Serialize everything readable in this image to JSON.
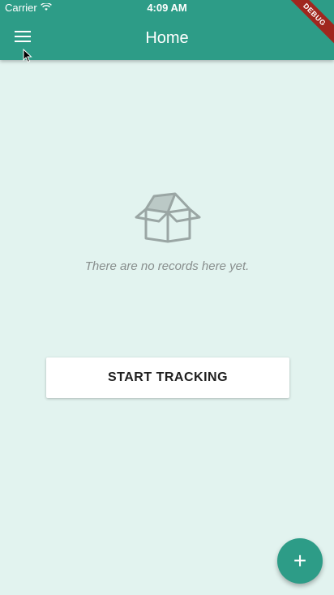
{
  "status_bar": {
    "carrier": "Carrier",
    "time": "4:09 AM",
    "wifi_icon": "wifi-icon"
  },
  "app_bar": {
    "title": "Home",
    "menu_icon": "menu-icon",
    "debug_banner": "DEBUG"
  },
  "empty_state": {
    "icon": "open-box-icon",
    "message": "There are no records here yet."
  },
  "actions": {
    "start_tracking_label": "START TRACKING",
    "fab_icon": "plus-icon",
    "fab_symbol": "+"
  },
  "colors": {
    "primary": "#2d9c87",
    "background": "#e2f3ef",
    "debug": "#a0271e"
  }
}
